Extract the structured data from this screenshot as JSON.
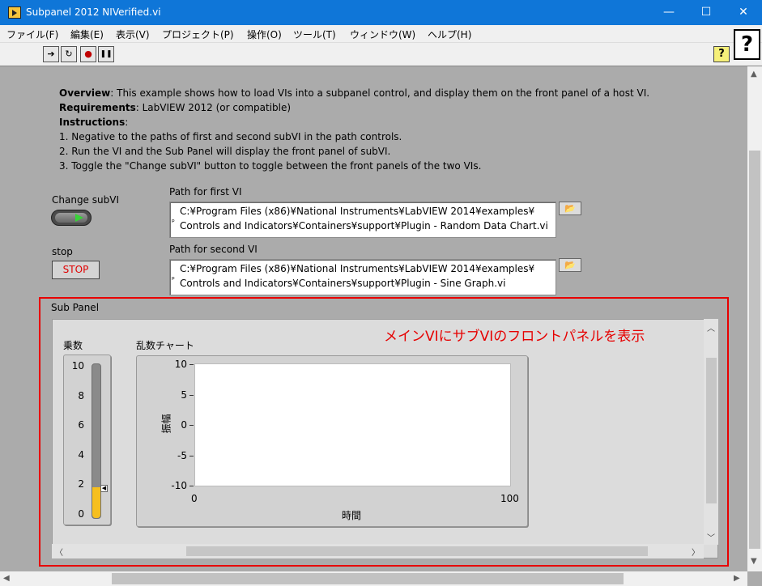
{
  "window": {
    "title": "Subpanel 2012 NIVerified.vi",
    "controls": {
      "minimize": "—",
      "maximize": "☐",
      "close": "✕"
    }
  },
  "menu": [
    "ファイル(F)",
    "編集(E)",
    "表示(V)",
    "プロジェクト(P)",
    "操作(O)",
    "ツール(T)",
    "ウィンドウ(W)",
    "ヘルプ(H)"
  ],
  "toolbar": {
    "buttons": [
      {
        "name": "run-arrow-icon",
        "glyph": "➔"
      },
      {
        "name": "run-continuously-icon",
        "glyph": "↻"
      },
      {
        "name": "abort-icon",
        "glyph": "●"
      },
      {
        "name": "pause-icon",
        "glyph": "❚❚"
      }
    ],
    "context_help": "?",
    "help": "?"
  },
  "description": {
    "overview_label": "Overview",
    "overview_text": ": This example shows how to load VIs into a subpanel control, and display them on the front panel of a host VI.",
    "requirements_label": "Requirements",
    "requirements_text": ": LabVIEW 2012 (or compatible)",
    "instructions_label": "Instructions",
    "instructions_colon": ":",
    "steps": [
      "1. Negative to the paths of first and second  subVI  in the path controls.",
      "2. Run the VI and the Sub Panel will display the front panel of subVI.",
      "3. Toggle the \"Change subVI\" button to toggle between the front panels of the two VIs."
    ]
  },
  "controls": {
    "change_subvi_label": "Change subVI",
    "stop_label": "stop",
    "stop_button": "STOP",
    "path1_label": "Path for first VI",
    "path1_line1": "C:¥Program Files (x86)¥National Instruments¥LabVIEW 2014¥examples¥",
    "path1_line2": "Controls and Indicators¥Containers¥support¥Plugin - Random Data Chart.vi",
    "path2_label": "Path for second VI",
    "path2_line1": "C:¥Program Files (x86)¥National Instruments¥LabVIEW 2014¥examples¥",
    "path2_line2": "Controls and Indicators¥Containers¥support¥Plugin - Sine Graph.vi",
    "browse_glyph": "📂",
    "path_icon_glyph": "ᵖ"
  },
  "subpanel": {
    "label": "Sub Panel",
    "annotation": "メインVIにサブVIのフロントパネルを表示",
    "tank": {
      "label": "乗数",
      "ticks": [
        "10",
        "8",
        "6",
        "4",
        "2",
        "0"
      ],
      "value": 2,
      "max": 10
    },
    "chart": {
      "label": "乱数チャート",
      "ylabel": "振幅",
      "xlabel": "時間"
    }
  },
  "chart_data": {
    "type": "line",
    "title": "乱数チャート",
    "xlabel": "時間",
    "ylabel": "振幅",
    "xlim": [
      0,
      100
    ],
    "ylim": [
      -10,
      10
    ],
    "x_ticks": [
      "0",
      "100"
    ],
    "y_ticks": [
      "10",
      "5",
      "0",
      "-5",
      "-10"
    ],
    "series": []
  }
}
